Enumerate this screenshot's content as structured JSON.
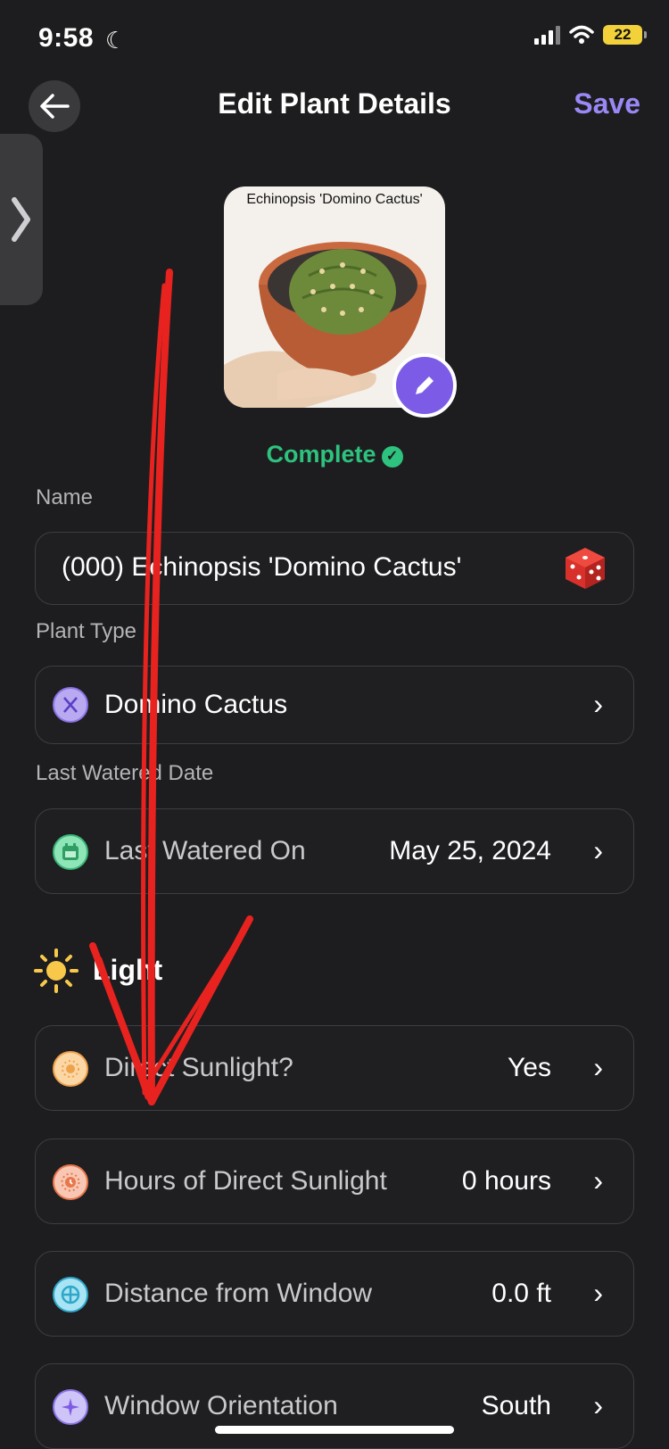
{
  "status_bar": {
    "time": "9:58",
    "battery": "22"
  },
  "header": {
    "title": "Edit Plant Details",
    "save_label": "Save"
  },
  "photo": {
    "caption": "Echinopsis 'Domino Cactus'"
  },
  "status": {
    "label": "Complete"
  },
  "name": {
    "label": "Name",
    "value": "(000) Echinopsis 'Domino Cactus'"
  },
  "plant_type": {
    "label": "Plant Type",
    "value": "Domino Cactus"
  },
  "last_watered": {
    "label": "Last Watered Date",
    "field_label": "Last Watered On",
    "value": "May 25, 2024"
  },
  "light": {
    "section_title": "Light",
    "items": [
      {
        "label": "Direct Sunlight?",
        "value": "Yes"
      },
      {
        "label": "Hours of Direct Sunlight",
        "value": "0 hours"
      },
      {
        "label": "Distance from Window",
        "value": "0.0 ft"
      },
      {
        "label": "Window Orientation",
        "value": "South"
      }
    ]
  },
  "colors": {
    "accent": "#7c5ce6",
    "save": "#9b87f5",
    "complete": "#2ec27e",
    "annotation": "#e8231f"
  }
}
